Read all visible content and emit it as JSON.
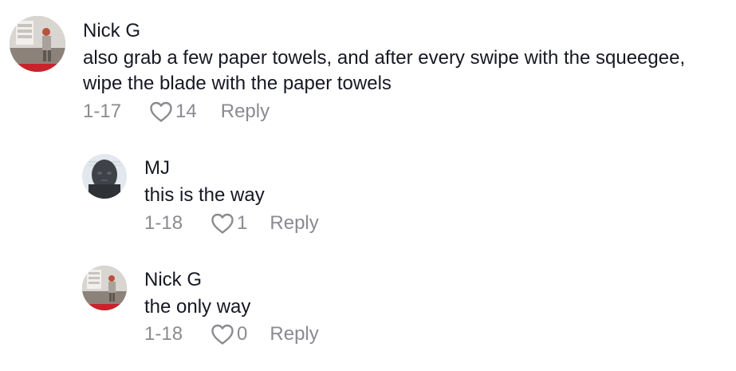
{
  "comments": [
    {
      "author": "Nick G",
      "avatar": "nick-g-avatar",
      "text_lines": [
        "also grab a few paper towels, and after every swipe with the squeegee,",
        "wipe the blade with the paper towels"
      ],
      "date": "1-17",
      "likes": "14",
      "reply_label": "Reply"
    }
  ],
  "replies": [
    {
      "author": "MJ",
      "avatar": "mj-avatar",
      "text": "this is the way",
      "date": "1-18",
      "likes": "1",
      "reply_label": "Reply"
    },
    {
      "author": "Nick G",
      "avatar": "nick-g-avatar",
      "text": "the only way",
      "date": "1-18",
      "likes": "0",
      "reply_label": "Reply"
    }
  ],
  "icons": {
    "like": "heart-outline-icon"
  },
  "colors": {
    "text_primary": "#161823",
    "text_secondary": "#8a8b91",
    "background": "#ffffff"
  }
}
